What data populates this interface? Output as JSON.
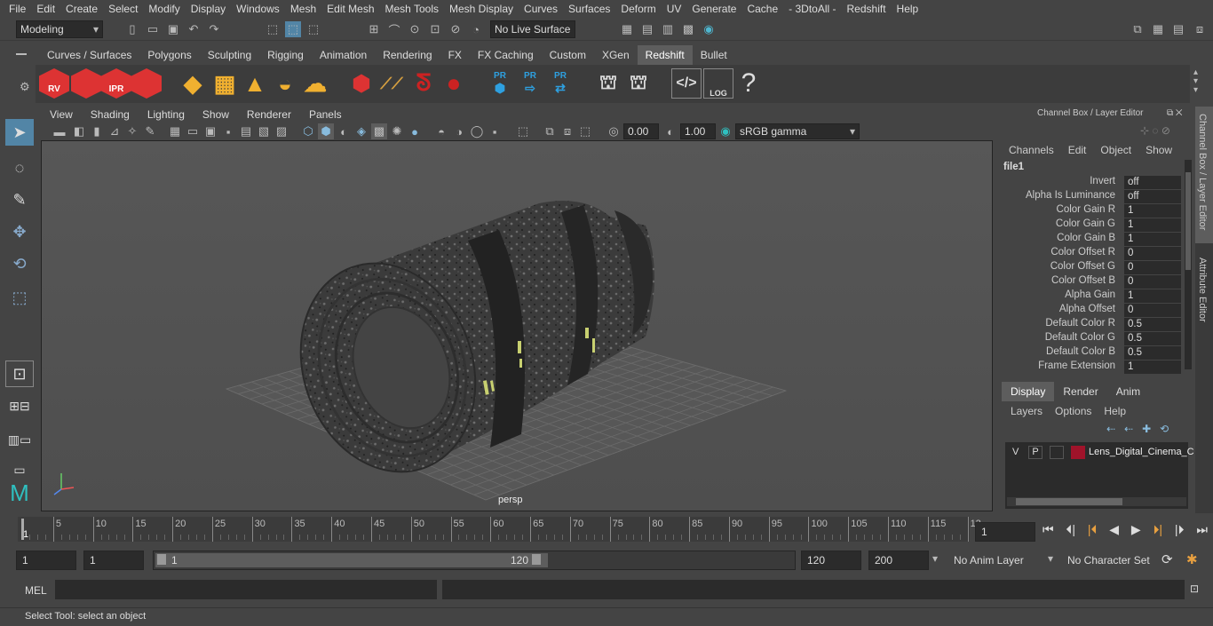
{
  "menubar": [
    "File",
    "Edit",
    "Create",
    "Select",
    "Modify",
    "Display",
    "Windows",
    "Mesh",
    "Edit Mesh",
    "Mesh Tools",
    "Mesh Display",
    "Curves",
    "Surfaces",
    "Deform",
    "UV",
    "Generate",
    "Cache",
    "- 3DtoAll -",
    "Redshift",
    "Help"
  ],
  "statusline": {
    "mode": "Modeling",
    "live_surface": "No Live Surface"
  },
  "shelf_tabs": [
    "Curves / Surfaces",
    "Polygons",
    "Sculpting",
    "Rigging",
    "Animation",
    "Rendering",
    "FX",
    "FX Caching",
    "Custom",
    "XGen",
    "Redshift",
    "Bullet"
  ],
  "shelf_active": "Redshift",
  "shelf_labels": {
    "rv": "RV",
    "ipr": "IPR",
    "pr": "PR",
    "log": "LOG",
    "help": "?"
  },
  "viewport": {
    "menus": [
      "View",
      "Shading",
      "Lighting",
      "Show",
      "Renderer",
      "Panels"
    ],
    "exposure": "0.00",
    "gamma": "1.00",
    "colorspace": "sRGB gamma",
    "camera_label": "persp"
  },
  "channelbox": {
    "title": "Channel Box / Layer Editor",
    "menus": [
      "Channels",
      "Edit",
      "Object",
      "Show"
    ],
    "node": "file1",
    "attributes": [
      {
        "name": "Invert",
        "value": "off"
      },
      {
        "name": "Alpha Is Luminance",
        "value": "off"
      },
      {
        "name": "Color Gain R",
        "value": "1"
      },
      {
        "name": "Color Gain G",
        "value": "1"
      },
      {
        "name": "Color Gain B",
        "value": "1"
      },
      {
        "name": "Color Offset R",
        "value": "0"
      },
      {
        "name": "Color Offset G",
        "value": "0"
      },
      {
        "name": "Color Offset B",
        "value": "0"
      },
      {
        "name": "Alpha Gain",
        "value": "1"
      },
      {
        "name": "Alpha Offset",
        "value": "0"
      },
      {
        "name": "Default Color R",
        "value": "0.5"
      },
      {
        "name": "Default Color G",
        "value": "0.5"
      },
      {
        "name": "Default Color B",
        "value": "0.5"
      },
      {
        "name": "Frame Extension",
        "value": "1"
      }
    ]
  },
  "side_tabs": [
    "Channel Box / Layer Editor",
    "Attribute Editor"
  ],
  "layer_editor": {
    "tabs": [
      "Display",
      "Render",
      "Anim"
    ],
    "menus": [
      "Layers",
      "Options",
      "Help"
    ],
    "layer": {
      "v": "V",
      "p": "P",
      "name": "Lens_Digital_Cinema_C",
      "color": "#a0132a"
    }
  },
  "timeline": {
    "ticks": [
      "5",
      "10",
      "15",
      "20",
      "25",
      "30",
      "35",
      "40",
      "45",
      "50",
      "55",
      "60",
      "65",
      "70",
      "75",
      "80",
      "85",
      "90",
      "95",
      "100",
      "105",
      "110",
      "115",
      "12"
    ],
    "first_label": "1",
    "current_frame": "1"
  },
  "range": {
    "start": "1",
    "current": "1",
    "slider_start": "1",
    "slider_end": "120",
    "end": "120",
    "anim_end": "200",
    "anim_layer": "No Anim Layer",
    "char_set": "No Character Set"
  },
  "cmdline": {
    "lang": "MEL"
  },
  "helpline": "Select Tool: select an object"
}
